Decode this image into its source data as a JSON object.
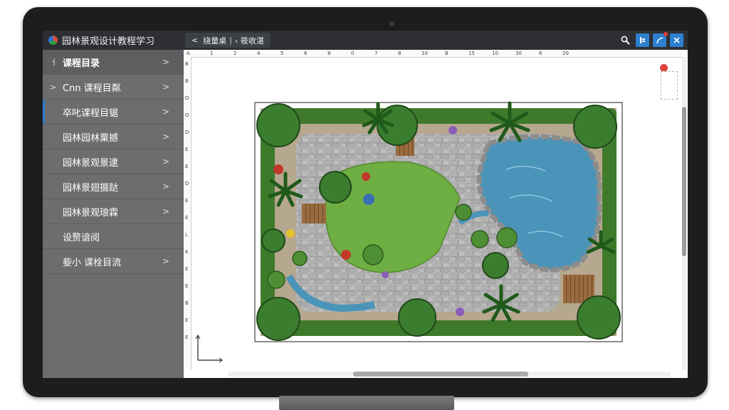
{
  "app": {
    "title": "园林景观设计教程学习"
  },
  "breadcrumb": {
    "back": "<",
    "item1": "绕量桌",
    "separator": "|",
    "item2": "‹ 筱收湛"
  },
  "toolbar": {
    "icons": [
      "search-icon",
      "bookmark-icon",
      "pen-icon",
      "close-icon"
    ]
  },
  "sidebar": {
    "items": [
      {
        "label": "课程目录",
        "lead": "ㅓ",
        "chevron": ">"
      },
      {
        "label": "Cnn 课程目粼",
        "lead": ">",
        "chevron": ">"
      },
      {
        "label": "卒叱课程目锯",
        "lead": "",
        "chevron": ">"
      },
      {
        "label": "园林园林粟撼",
        "lead": "",
        "chevron": ">"
      },
      {
        "label": "园林景观景逮",
        "lead": "",
        "chevron": ">"
      },
      {
        "label": "园林景翅摄跶",
        "lead": "",
        "chevron": ">"
      },
      {
        "label": "园林景观琅霖",
        "lead": "",
        "chevron": ">"
      },
      {
        "label": "设赘谙阅",
        "lead": "",
        "chevron": ""
      },
      {
        "label": "姕小 课栓目流",
        "lead": "",
        "chevron": ">"
      }
    ]
  },
  "rulers": {
    "top": [
      "A",
      "1",
      "2",
      "4",
      "5",
      "6",
      "8",
      "0",
      "7",
      "8",
      "10",
      "B",
      "15",
      "10",
      "30",
      "6",
      "20"
    ],
    "left": [
      "B",
      "B",
      "O",
      "O",
      "D",
      "E",
      "E",
      "D",
      "E",
      "E",
      "L",
      "K",
      "E",
      "E",
      "B",
      "E",
      "E"
    ]
  },
  "colors": {
    "titlebar": "#2d2f33",
    "sidebar": "#6d6d6f",
    "accent": "#2d7fd0",
    "water": "#4a94b9",
    "lawn": "#6fae42",
    "paving": "#bdbdbd"
  }
}
